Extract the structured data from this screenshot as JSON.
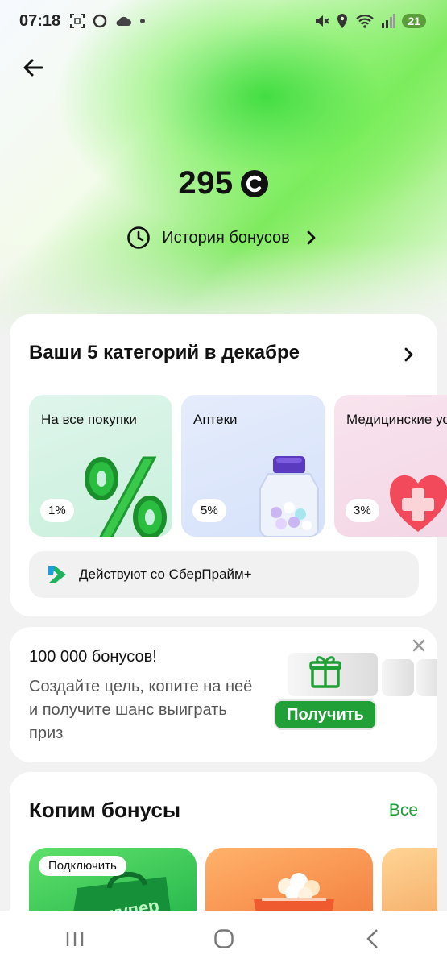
{
  "status_bar": {
    "time": "07:18",
    "battery": "21",
    "left_icons": [
      "screenshot-icon",
      "chat-bubble-icon",
      "cloud-icon",
      "dot-icon"
    ],
    "right_icons": [
      "mute-icon",
      "location-icon",
      "wifi-icon",
      "signal-icon"
    ]
  },
  "header": {
    "balance": "295",
    "currency_icon": "sber-coin-icon",
    "history_label": "История бонусов"
  },
  "categories": {
    "title": "Ваши 5 категорий в декабре",
    "tiles": [
      {
        "label": "На все покупки",
        "percent": "1%",
        "icon": "percent-3d-icon"
      },
      {
        "label": "Аптеки",
        "percent": "5%",
        "icon": "pill-bottle-icon"
      },
      {
        "label": "Медицинские услуги",
        "percent": "3%",
        "icon": "medical-heart-icon"
      }
    ],
    "prime_text": "Действуют со СберПрайм+"
  },
  "promo": {
    "title": "100 000 бонусов!",
    "description": "Создайте цель, копите на неё и получите шанс выиграть приз",
    "button": "Получить"
  },
  "saving": {
    "title": "Копим бонусы",
    "all_link": "Все",
    "cards": [
      {
        "badge": "Подключить"
      }
    ]
  },
  "colors": {
    "accent_green": "#21a038",
    "hero_green": "#5fe03f"
  }
}
